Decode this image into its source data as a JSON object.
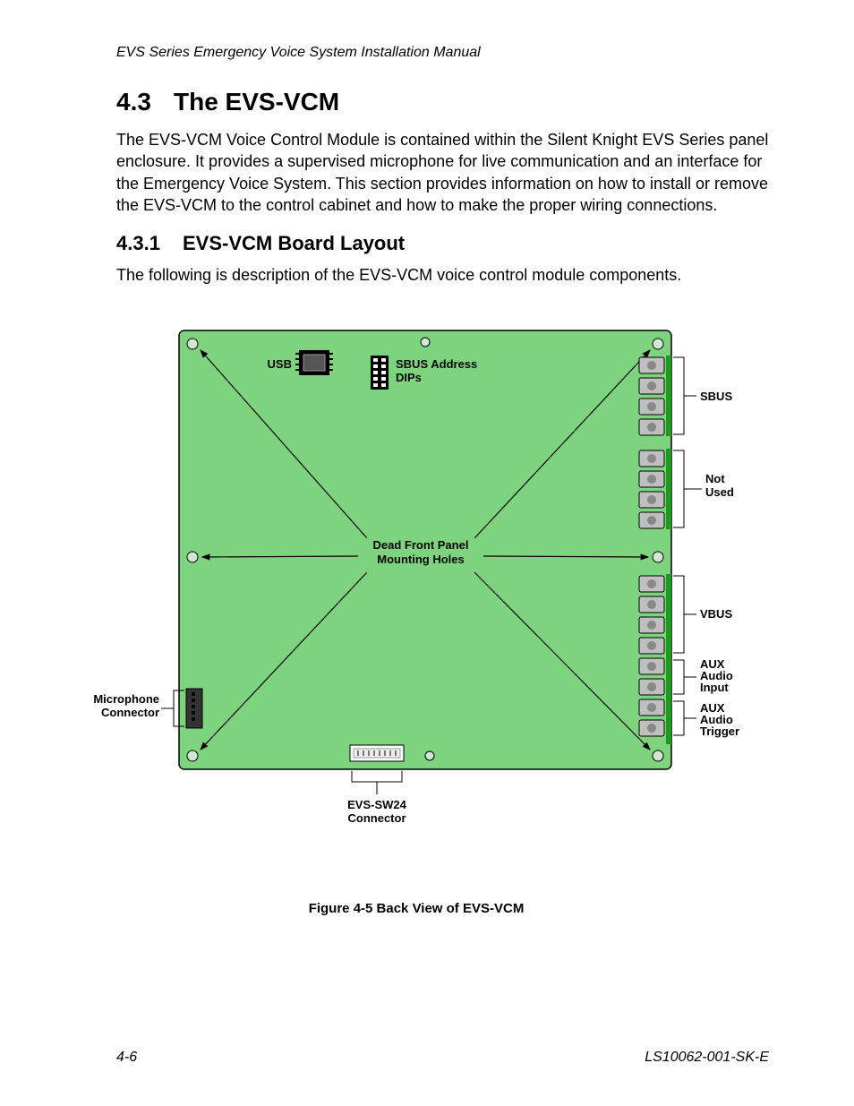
{
  "header": "EVS Series Emergency Voice System Installation Manual",
  "section": {
    "number": "4.3",
    "title": "The EVS-VCM",
    "paragraph": "The EVS-VCM Voice Control Module is contained within the Silent Knight EVS Series panel enclosure. It provides a supervised microphone for live communication and an interface for the Emergency Voice System. This section provides information on how to install or remove the EVS-VCM to the control cabinet and how to make the proper wiring connections."
  },
  "subsection": {
    "number": "4.3.1",
    "title": "EVS-VCM Board Layout",
    "paragraph": "The following is description of the EVS-VCM voice control module components."
  },
  "figure": {
    "labels": {
      "usb": "USB",
      "sbus_dips_l1": "SBUS Address",
      "sbus_dips_l2": "DIPs",
      "dead_front_l1": "Dead Front Panel",
      "dead_front_l2": "Mounting Holes",
      "sbus": "SBUS",
      "not_used_l1": "Not",
      "not_used_l2": "Used",
      "vbus": "VBUS",
      "aux_in_l1": "AUX",
      "aux_in_l2": "Audio",
      "aux_in_l3": "Input",
      "aux_trig_l1": "AUX",
      "aux_trig_l2": "Audio",
      "aux_trig_l3": "Trigger",
      "mic_l1": "Microphone",
      "mic_l2": "Connector",
      "evs_sw24_l1": "EVS-SW24",
      "evs_sw24_l2": "Connector"
    },
    "caption": "Figure 4-5  Back View of EVS-VCM"
  },
  "footer": {
    "page": "4-6",
    "docnum": "LS10062-001-SK-E"
  }
}
